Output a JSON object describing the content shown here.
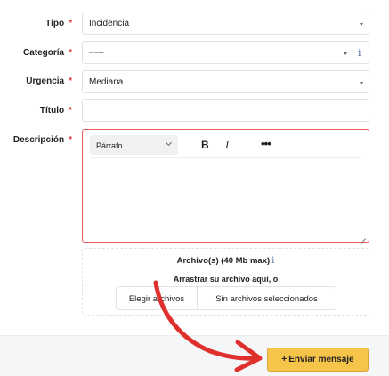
{
  "form": {
    "tipo": {
      "label": "Tipo",
      "required": "*",
      "value": "Incidencia"
    },
    "categoria": {
      "label": "Categoría",
      "required": "*",
      "value": "-----",
      "info": "i"
    },
    "urgencia": {
      "label": "Urgencia",
      "required": "*",
      "value": "Mediana"
    },
    "titulo": {
      "label": "Título",
      "required": "*",
      "value": ""
    },
    "descripcion": {
      "label": "Descripción",
      "required": "*",
      "toolbar": {
        "format": "Párrafo",
        "bold": "B",
        "italic": "I",
        "more": "•••"
      }
    }
  },
  "attachments": {
    "title": "Archivo(s) (40 Mb max)",
    "info": "i",
    "drag_text": "Arrastrar su archivo aquí, o",
    "choose_button": "Elegir archivos",
    "no_files": "Sin archivos seleccionados"
  },
  "footer": {
    "send_plus": "+",
    "send_label": "Enviar mensaje"
  },
  "colors": {
    "required": "#e53935",
    "editor_border_error": "#e85a5a",
    "send_button": "#f7c44a",
    "annotation_arrow": "#e0302e",
    "info_icon": "#4a6fa5"
  }
}
